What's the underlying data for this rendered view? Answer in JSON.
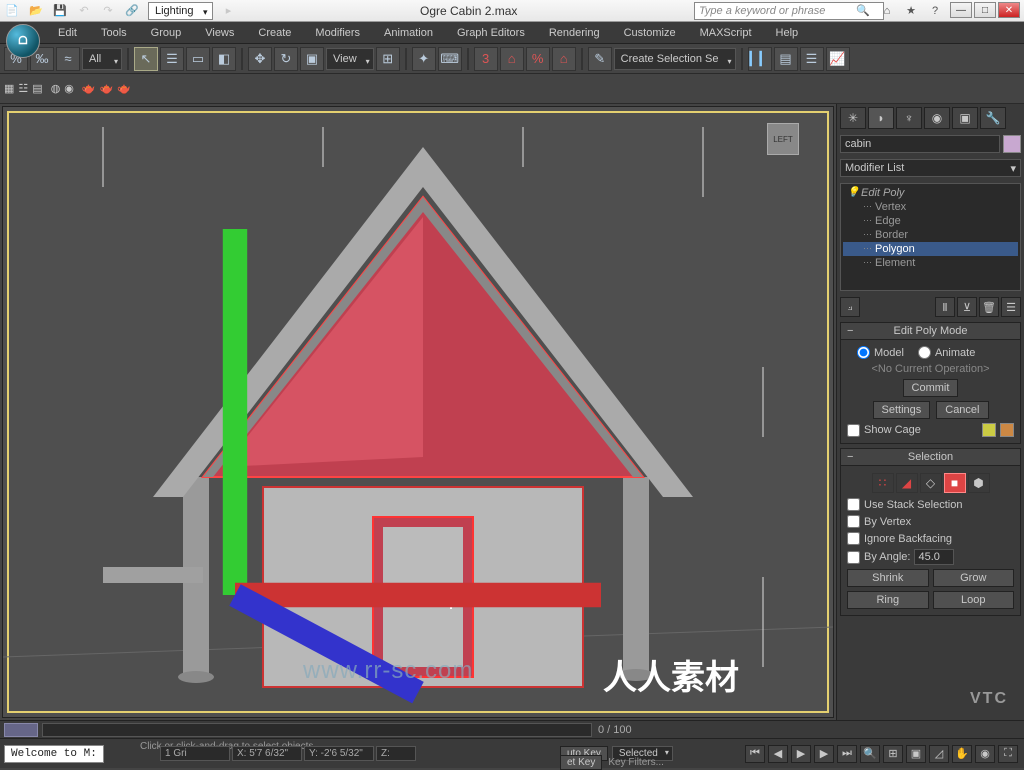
{
  "titlebar": {
    "workspace_dropdown": "Lighting",
    "filename": "Ogre Cabin 2.max",
    "search_placeholder": "Type a keyword or phrase"
  },
  "menu": [
    "Edit",
    "Tools",
    "Group",
    "Views",
    "Create",
    "Modifiers",
    "Animation",
    "Graph Editors",
    "Rendering",
    "Customize",
    "MAXScript",
    "Help"
  ],
  "toolbar": {
    "filter_dropdown": "All",
    "ref_dropdown": "View",
    "sel_set_dropdown": "Create Selection Se",
    "angle_label": "3"
  },
  "viewport": {
    "cube_face": "LEFT"
  },
  "panel": {
    "object_name": "cabin",
    "modifier_list_label": "Modifier List",
    "stack": {
      "top": "Edit Poly",
      "subs": [
        "Vertex",
        "Edge",
        "Border",
        "Polygon",
        "Element"
      ],
      "selected": "Polygon"
    },
    "edit_poly": {
      "title": "Edit Poly Mode",
      "radio_model": "Model",
      "radio_animate": "Animate",
      "no_op": "<No Current Operation>",
      "commit": "Commit",
      "settings": "Settings",
      "cancel": "Cancel",
      "show_cage": "Show Cage"
    },
    "selection": {
      "title": "Selection",
      "use_stack": "Use Stack Selection",
      "by_vertex": "By Vertex",
      "ignore_back": "Ignore Backfacing",
      "by_angle": "By Angle:",
      "angle_value": "45.0",
      "shrink": "Shrink",
      "grow": "Grow",
      "ring": "Ring",
      "loop": "Loop"
    }
  },
  "timeline": {
    "range": "0 / 100"
  },
  "status": {
    "welcome": "Welcome to M:",
    "hint": "Click or click-and-drag to select objects",
    "grid": "1 Gri",
    "x": "X: 5'7 6/32\"",
    "y": "Y: -2'6 5/32\"",
    "z": "Z:",
    "auto_key": "uto Key",
    "set_key": "et Key",
    "selected": "Selected",
    "key_filters": "Key Filters..."
  },
  "watermark": "www.rr-sc.com",
  "watermark_cn": "人人素材",
  "vtc": "VTC"
}
